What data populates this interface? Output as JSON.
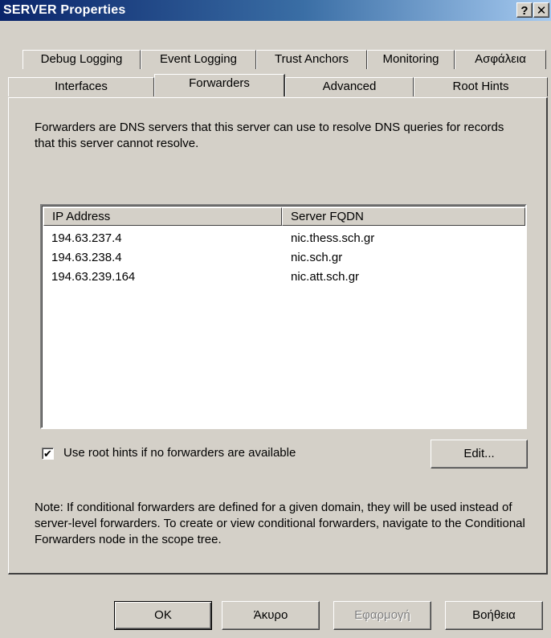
{
  "window": {
    "title": "SERVER Properties",
    "help_label": "?",
    "close_label": "✕"
  },
  "tabs": {
    "row1": [
      "Debug Logging",
      "Event Logging",
      "Trust Anchors",
      "Monitoring",
      "Ασφάλεια"
    ],
    "row2": [
      "Interfaces",
      "Forwarders",
      "Advanced",
      "Root Hints"
    ],
    "active": "Forwarders"
  },
  "forwarders": {
    "description": "Forwarders are DNS servers that this server can use to resolve DNS queries for records that this server cannot resolve.",
    "columns": [
      "IP Address",
      "Server FQDN"
    ],
    "rows": [
      [
        "194.63.237.4",
        "nic.thess.sch.gr"
      ],
      [
        "194.63.238.4",
        "nic.sch.gr"
      ],
      [
        "194.63.239.164",
        "nic.att.sch.gr"
      ]
    ],
    "use_root_hints": {
      "label": "Use root hints if no forwarders are available",
      "checked": true
    },
    "edit_label": "Edit...",
    "note": "Note: If conditional forwarders are defined for a given domain, they will be used instead of server-level forwarders.  To create or view conditional forwarders, navigate to the Conditional Forwarders node in the scope tree."
  },
  "buttons": {
    "ok": "OK",
    "cancel": "Άκυρο",
    "apply": "Εφαρμογή",
    "help": "Βοήθεια"
  }
}
